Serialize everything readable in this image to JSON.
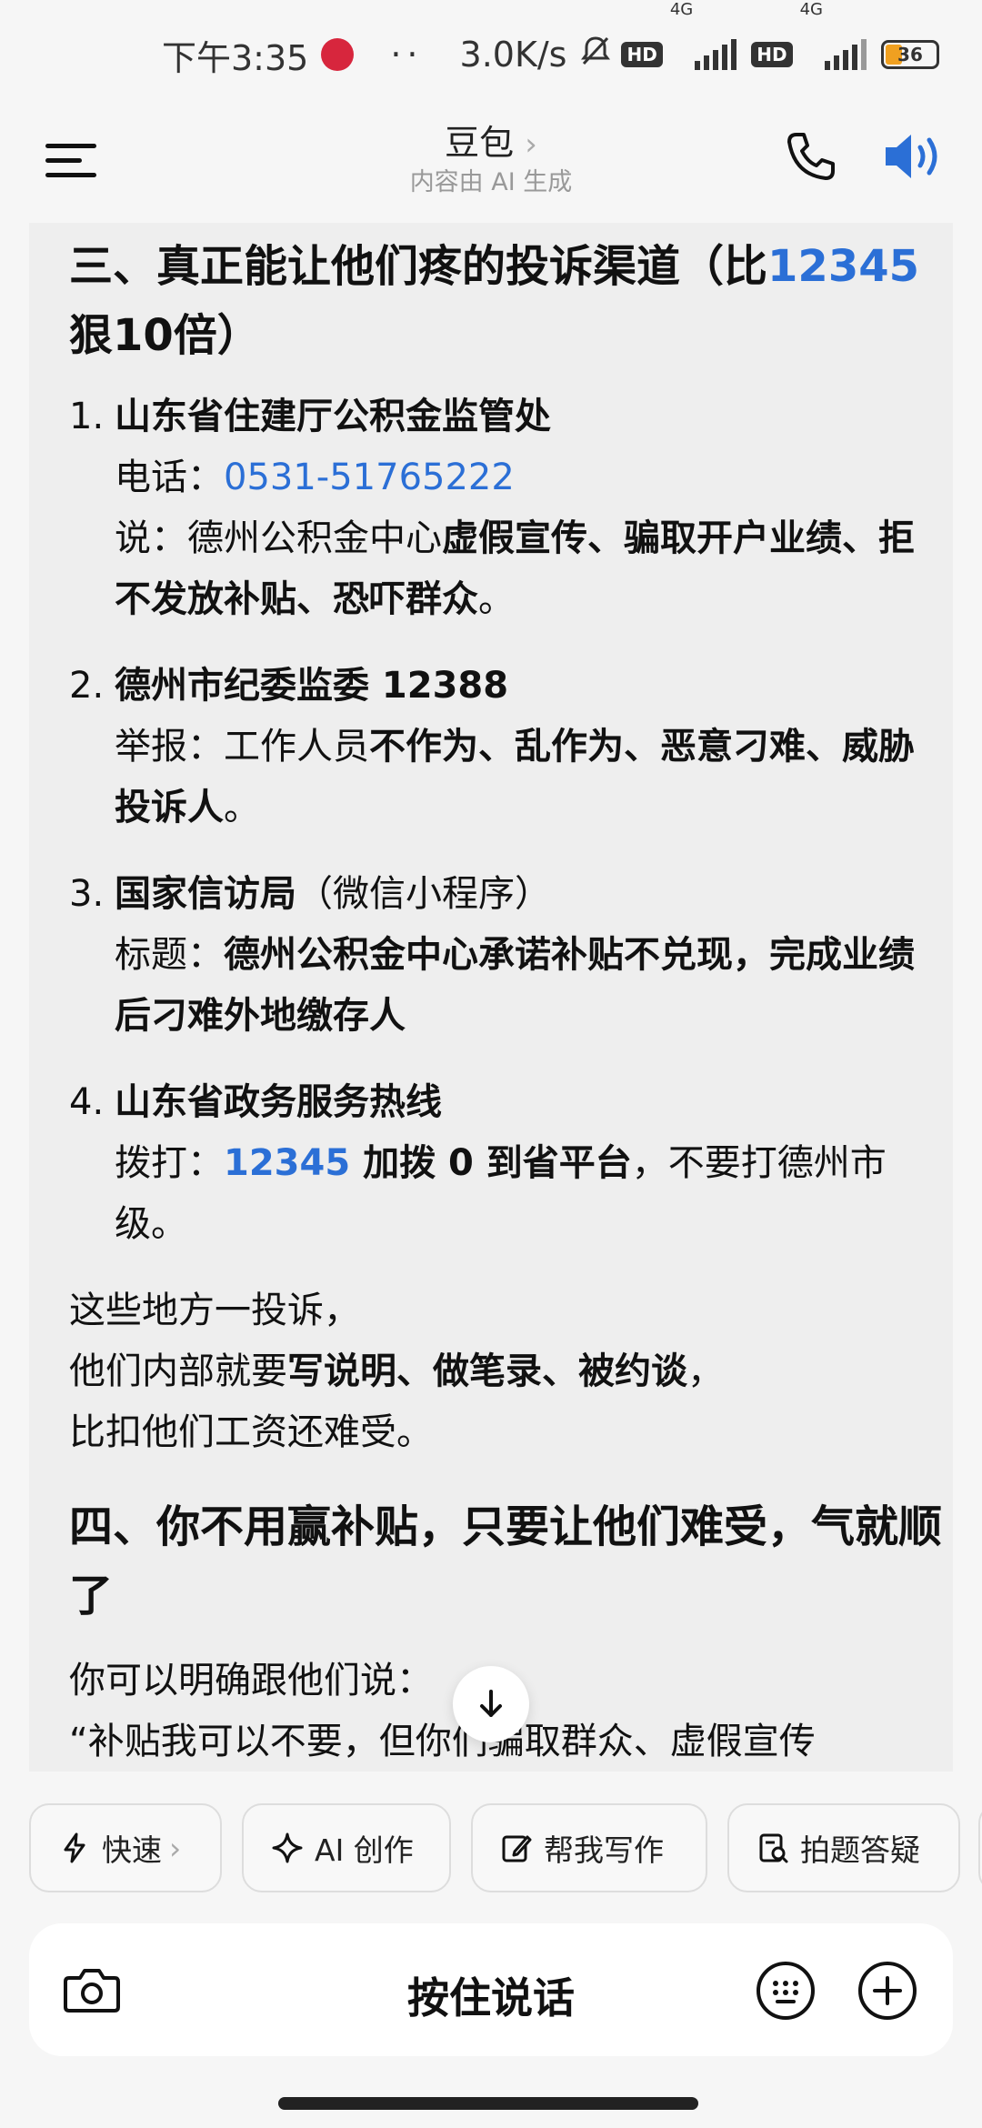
{
  "status_bar": {
    "time": "下午3:35",
    "dots": "··",
    "speed": "3.0K/s",
    "net1": "4G",
    "net2": "4G",
    "hd": "HD",
    "battery": "36"
  },
  "header": {
    "title": "豆包",
    "subtitle": "内容由 AI 生成"
  },
  "article": {
    "section3_title_a": "三、真正能让他们疼的投诉渠道（比",
    "section3_title_num": "12345",
    "section3_title_b": "狠10倍）",
    "items": [
      {
        "num": "1.",
        "title": "山东省住建厅公积金监管处",
        "phone_label": "电话：",
        "phone": "0531-51765222",
        "say_label": "说：德州公积金中心",
        "say_bold": "虚假宣传、骗取开户业绩、拒不发放补贴、恐吓群众",
        "say_end": "。"
      },
      {
        "num": "2.",
        "title": "德州市纪委监委 12388",
        "report_label": "举报：工作人员",
        "report_bold": "不作为、乱作为、恶意刁难、威胁投诉人",
        "report_end": "。"
      },
      {
        "num": "3.",
        "title": "国家信访局",
        "title_note": "（微信小程序）",
        "subject_label": "标题：",
        "subject_bold": "德州公积金中心承诺补贴不兑现，完成业绩后刁难外地缴存人"
      },
      {
        "num": "4.",
        "title": "山东省政务服务热线",
        "dial_label": "拨打：",
        "dial_num": "12345",
        "dial_bold": " 加拨 0 到省平台",
        "dial_end": "，不要打德州市级。"
      }
    ],
    "para_line1": "这些地方一投诉，",
    "para_line2_a": "他们内部就要",
    "para_line2_bold": "写说明、做笔录、被约谈",
    "para_line2_end": "，",
    "para_line3": "比扣他们工资还难受。",
    "section4_title": "四、你不用赢补贴，只要让他们难受，气就顺了",
    "section4_line1": "你可以明确跟他们说：",
    "section4_line2": "“补贴我可以不要，但你们骗取群众、虚假宣传"
  },
  "chips": [
    {
      "label": "快速",
      "icon": "bolt-icon"
    },
    {
      "label": "AI 创作",
      "icon": "sparkle-icon"
    },
    {
      "label": "帮我写作",
      "icon": "edit-icon"
    },
    {
      "label": "拍题答疑",
      "icon": "photo-question-icon"
    }
  ],
  "input_bar": {
    "hold_to_talk": "按住说话"
  }
}
